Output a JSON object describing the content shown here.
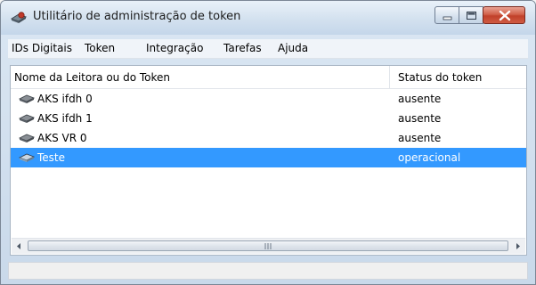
{
  "window": {
    "title": "Utilitário de administração de token",
    "app_icon": "token-reader-icon"
  },
  "title_buttons": {
    "minimize_icon": "minimize-icon",
    "maximize_icon": "maximize-icon",
    "close_icon": "close-icon"
  },
  "menu": {
    "items": [
      {
        "label": "IDs Digitais"
      },
      {
        "label": "Token"
      },
      {
        "label": "Integração"
      },
      {
        "label": "Tarefas"
      },
      {
        "label": "Ajuda"
      }
    ]
  },
  "list": {
    "columns": {
      "name": "Nome da Leitora ou do Token",
      "status": "Status do token"
    },
    "rows": [
      {
        "name": "AKS ifdh 0",
        "status": "ausente",
        "icon": "card-reader-icon",
        "selected": false
      },
      {
        "name": "AKS ifdh 1",
        "status": "ausente",
        "icon": "card-reader-icon",
        "selected": false
      },
      {
        "name": "AKS VR 0",
        "status": "ausente",
        "icon": "card-reader-icon",
        "selected": false
      },
      {
        "name": "Teste",
        "status": "operacional",
        "icon": "card-reader-icon",
        "selected": true
      }
    ]
  },
  "colors": {
    "selection": "#3399ff",
    "close_button": "#c1412a"
  }
}
